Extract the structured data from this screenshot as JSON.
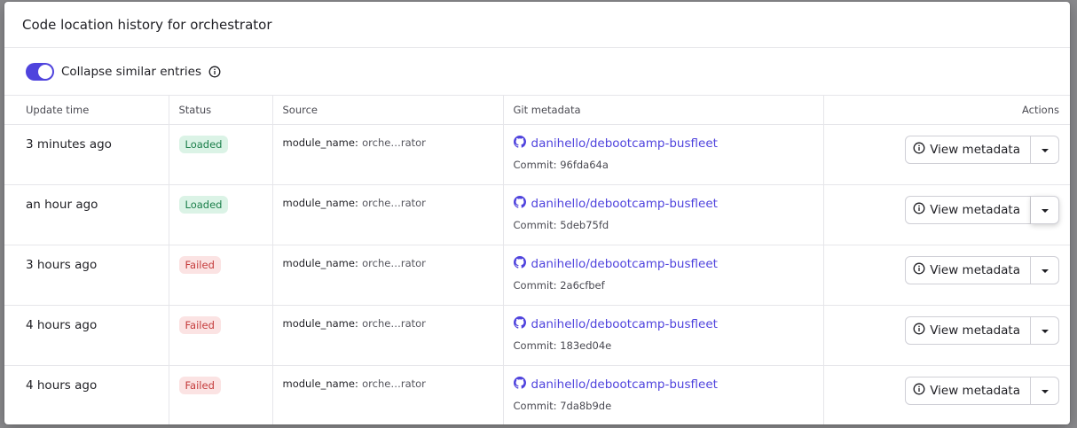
{
  "dialog": {
    "title": "Code location history for orchestrator"
  },
  "filter": {
    "toggle_on": true,
    "label": "Collapse similar entries"
  },
  "table": {
    "columns": [
      "Update time",
      "Status",
      "Source",
      "Git metadata",
      "Actions"
    ],
    "rows": [
      {
        "time": "3 minutes ago",
        "status": "Loaded",
        "source_key": "module_name:",
        "source_val": "orche…rator",
        "repo": "danihello/debootcamp-busfleet",
        "commit": "Commit: 96fda64a",
        "action": "View metadata"
      },
      {
        "time": "an hour ago",
        "status": "Loaded",
        "source_key": "module_name:",
        "source_val": "orche…rator",
        "repo": "danihello/debootcamp-busfleet",
        "commit": "Commit: 5deb75fd",
        "action": "View metadata"
      },
      {
        "time": "3 hours ago",
        "status": "Failed",
        "source_key": "module_name:",
        "source_val": "orche…rator",
        "repo": "danihello/debootcamp-busfleet",
        "commit": "Commit: 2a6cfbef",
        "action": "View metadata"
      },
      {
        "time": "4 hours ago",
        "status": "Failed",
        "source_key": "module_name:",
        "source_val": "orche…rator",
        "repo": "danihello/debootcamp-busfleet",
        "commit": "Commit: 183ed04e",
        "action": "View metadata"
      },
      {
        "time": "4 hours ago",
        "status": "Failed",
        "source_key": "module_name:",
        "source_val": "orche…rator",
        "repo": "danihello/debootcamp-busfleet",
        "commit": "Commit: 7da8b9de",
        "action": "View metadata"
      }
    ]
  },
  "colors": {
    "accent": "#4f43dd",
    "loaded_bg": "#dbf3e6",
    "loaded_fg": "#1b7f4a",
    "failed_bg": "#fbe3e3",
    "failed_fg": "#c43b3b"
  },
  "icons": {
    "info": "info-icon",
    "github": "github-icon",
    "caret": "chevron-down-icon"
  }
}
